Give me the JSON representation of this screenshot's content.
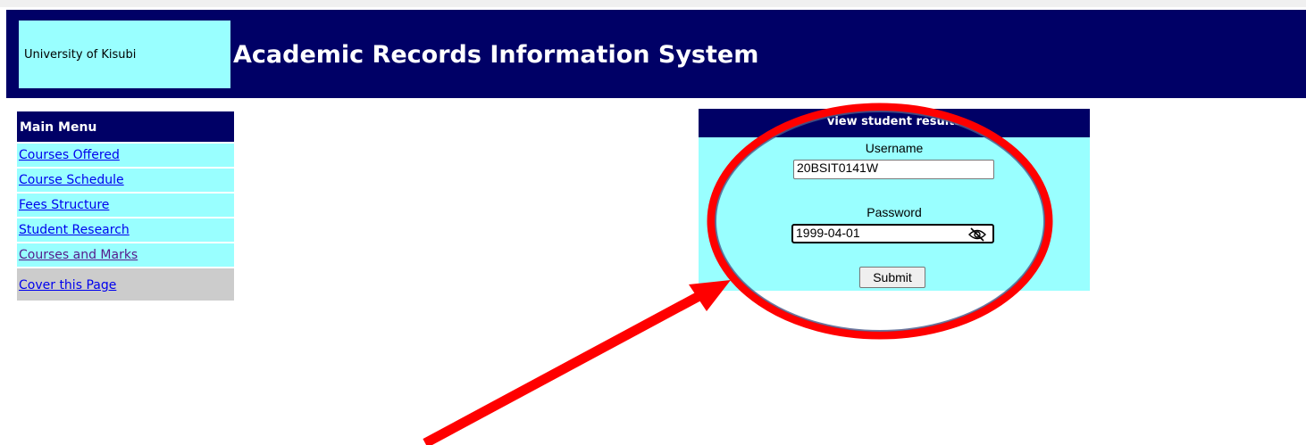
{
  "header": {
    "institution": "University of Kisubi",
    "title": "Academic Records Information System"
  },
  "sidebar": {
    "heading": "Main Menu",
    "items": [
      {
        "label": "Courses Offered"
      },
      {
        "label": "Course Schedule"
      },
      {
        "label": "Fees Structure"
      },
      {
        "label": "Student Research"
      },
      {
        "label": "Courses and Marks"
      }
    ],
    "cover_link": "Cover this Page"
  },
  "login": {
    "heading": "view student results",
    "username_label": "Username",
    "username_value": "20BSIT0141W",
    "password_label": "Password",
    "password_value": "1999-04-01",
    "submit_label": "Submit"
  },
  "colors": {
    "header_bg": "#000066",
    "panel_bg": "#99ffff",
    "annotation": "#ff0000"
  },
  "icons": {
    "password_toggle": "eye-slash-icon"
  }
}
